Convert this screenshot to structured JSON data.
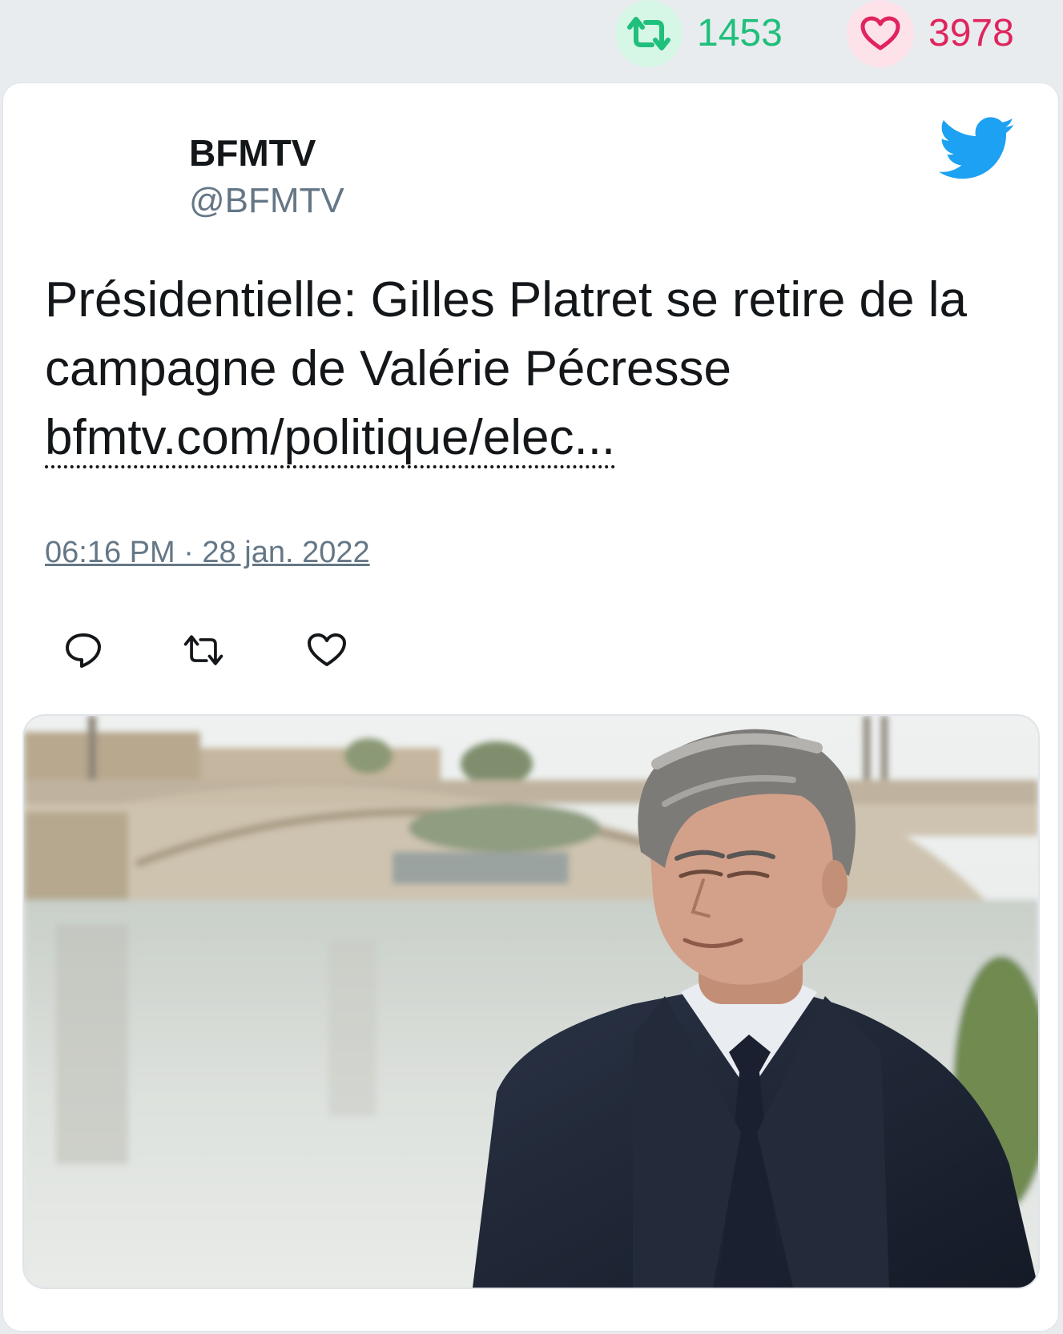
{
  "stats": {
    "retweet_icon": "retweet-icon",
    "retweet_count": "1453",
    "like_icon": "heart-icon",
    "like_count": "3978",
    "retweet_color": "#1fbf7c",
    "like_color": "#e0245e"
  },
  "tweet": {
    "display_name": "BFMTV",
    "handle": "@BFMTV",
    "text": "Présidentielle: Gilles Platret se retire de la campagne de Valérie Pécresse",
    "link": "bfmtv.com/politique/elec...",
    "timestamp": "06:16 PM · 28 jan. 2022",
    "logo_icon": "twitter-bird-icon",
    "brand_color": "#1da1f2"
  },
  "actions": {
    "reply_icon": "reply-icon",
    "retweet_icon": "retweet-icon",
    "like_icon": "heart-icon"
  },
  "media": {
    "description_icon": "photo-image"
  }
}
